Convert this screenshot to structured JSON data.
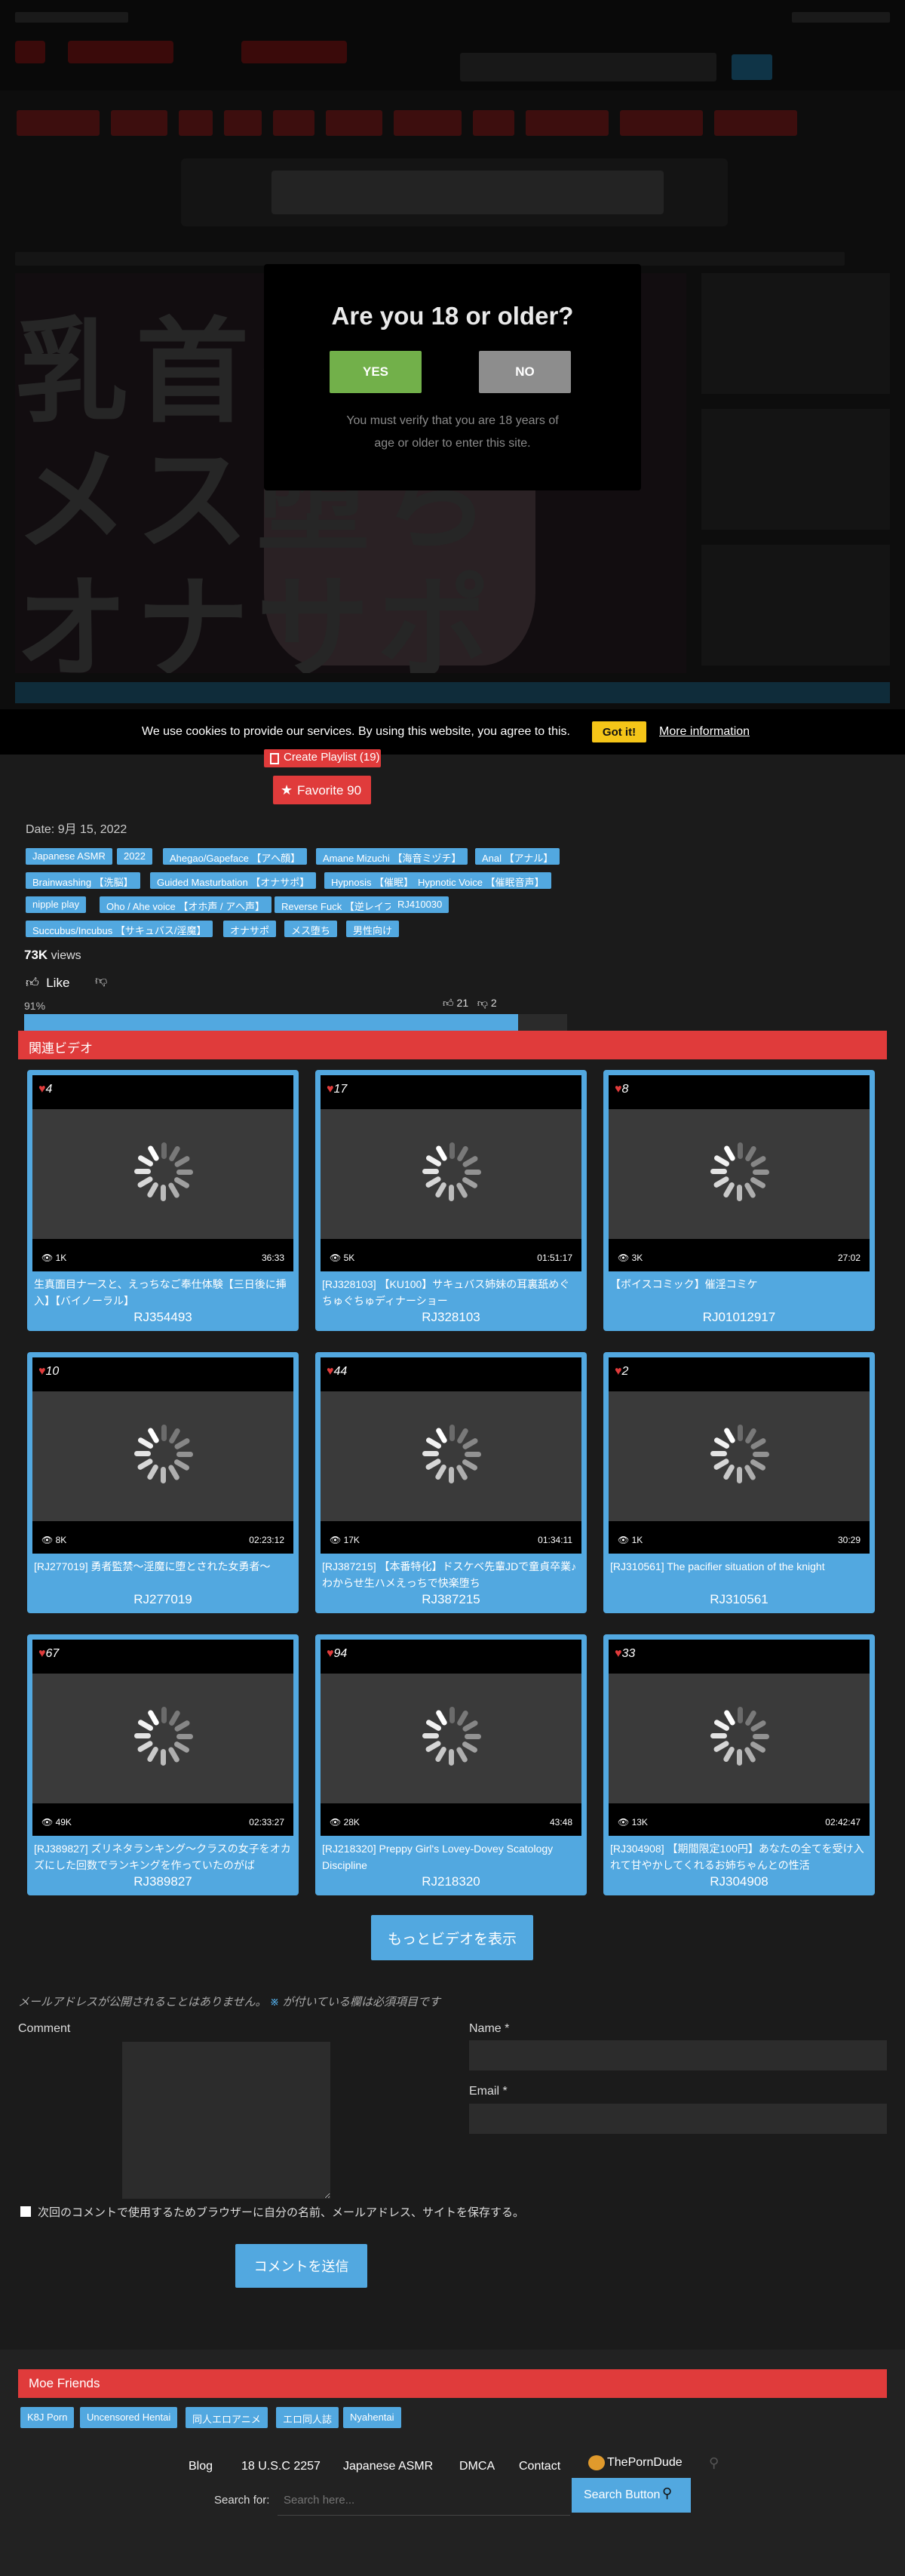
{
  "age_gate": {
    "title": "Are you 18 or older?",
    "yes_label": "YES",
    "no_label": "NO",
    "note": "You must verify that you are 18 years of age or older to enter this site."
  },
  "cookie": {
    "text": "We use cookies to provide our services. By using this website, you agree to this.",
    "ok_label": "Got it!",
    "more_label": "More information"
  },
  "actions": {
    "playlist_label": "Create Playlist (19)",
    "favorite_label": "Favorite 90"
  },
  "video": {
    "date": "Date: 9月 15, 2022",
    "tags": [
      "Japanese ASMR",
      "2022",
      "Ahegao/Gapeface 【アヘ顔】",
      "Amane Mizuchi 【海音ミヅチ】",
      "Anal 【アナル】",
      "Brainwashing 【洗脳】",
      "Guided Masturbation 【オナサポ】",
      "Hypnosis 【催眠】",
      "Hypnotic Voice 【催眠音声】",
      "nipple play",
      "Oho / Ahe voice 【オホ声 / アヘ声】",
      "Reverse Fuck 【逆レイプ】",
      "RJ410030",
      "Succubus/Incubus 【サキュバス/淫魔】",
      "オナサポ",
      "メス堕ち",
      "男性向け"
    ],
    "views_count": "73K",
    "views_label": "views",
    "like_label": "Like",
    "rating_percent": "91%",
    "rating_fraction": 0.91,
    "likes": "21",
    "dislikes": "2"
  },
  "related": {
    "title": "関連ビデオ",
    "more_label": "もっとビデオを表示",
    "cards": [
      {
        "favs": "4",
        "views": "1K",
        "duration": "36:33",
        "title": "生真面目ナースと、えっちなご奉仕体験【三日後に挿入】【バイノーラル】",
        "code": "RJ354493"
      },
      {
        "favs": "17",
        "views": "5K",
        "duration": "01:51:17",
        "title": "[RJ328103] 【KU100】サキュバス姉妹の耳裏舐めぐちゅぐちゅディナーショー",
        "code": "RJ328103"
      },
      {
        "favs": "8",
        "views": "3K",
        "duration": "27:02",
        "title": "【ボイスコミック】催淫コミケ",
        "code": "RJ01012917"
      },
      {
        "favs": "10",
        "views": "8K",
        "duration": "02:23:12",
        "title": "[RJ277019] 勇者監禁～淫魔に堕とされた女勇者～",
        "code": "RJ277019"
      },
      {
        "favs": "44",
        "views": "17K",
        "duration": "01:34:11",
        "title": "[RJ387215] 【本番特化】ドスケベ先輩JDで童貞卒業♪わからせ生ハメえっちで快楽堕ち",
        "code": "RJ387215"
      },
      {
        "favs": "2",
        "views": "1K",
        "duration": "30:29",
        "title": "[RJ310561] The pacifier situation of the knight",
        "code": "RJ310561"
      },
      {
        "favs": "67",
        "views": "49K",
        "duration": "02:33:27",
        "title": "[RJ389827] ズリネタランキング～クラスの女子をオカズにした回数でランキングを作っていたのがば",
        "code": "RJ389827"
      },
      {
        "favs": "94",
        "views": "28K",
        "duration": "43:48",
        "title": "[RJ218320] Preppy Girl's Lovey-Dovey Scatology Discipline",
        "code": "RJ218320"
      },
      {
        "favs": "33",
        "views": "13K",
        "duration": "02:42:47",
        "title": "[RJ304908] 【期間限定100円】あなたの全てを受け入れて甘やかしてくれるお姉ちゃんとの性活",
        "code": "RJ304908"
      }
    ]
  },
  "comment_form": {
    "note_prefix": "メールアドレスが公開されることはありません。",
    "note_mark": "※",
    "note_suffix": " が付いている欄は必須項目です",
    "comment_label": "Comment",
    "name_label": "Name *",
    "email_label": "Email *",
    "save_label": "次回のコメントで使用するためブラウザーに自分の名前、メールアドレス、サイトを保存する。",
    "submit_label": "コメントを送信"
  },
  "footer": {
    "friends_title": "Moe Friends",
    "friends": [
      "K8J Porn",
      "Uncensored Hentai",
      "同人エロアニメ",
      "エロ同人誌",
      "Nyahentai"
    ],
    "links": [
      "Blog",
      "18 U.S.C 2257",
      "Japanese ASMR",
      "DMCA",
      "Contact"
    ],
    "porndude": "ThePornDude",
    "search_for": "Search for:",
    "search_placeholder": "Search here...",
    "search_button": "Search Button"
  },
  "colors": {
    "accent_blue": "#52a8e0",
    "accent_red": "#e03b3b",
    "yes_green": "#72b04a",
    "cookie_yellow": "#f5c518"
  }
}
